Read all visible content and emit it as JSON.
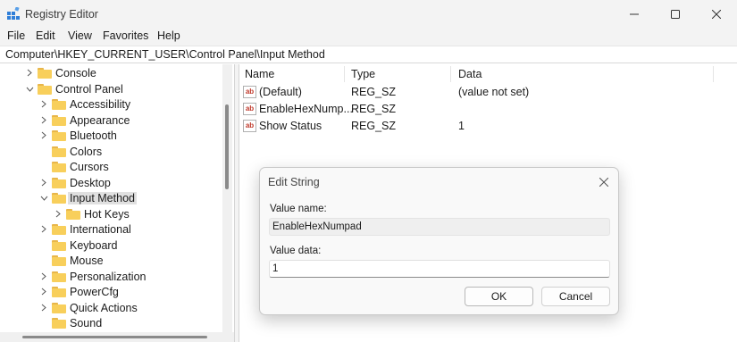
{
  "window": {
    "title": "Registry Editor",
    "icon": "registry-icon",
    "controls": {
      "minimize": "minimize-icon",
      "maximize": "maximize-icon",
      "close": "close-icon"
    }
  },
  "menu": [
    "File",
    "Edit",
    "View",
    "Favorites",
    "Help"
  ],
  "address": "Computer\\HKEY_CURRENT_USER\\Control Panel\\Input Method",
  "tree": [
    {
      "label": "Console",
      "expanded": false
    },
    {
      "label": "Control Panel",
      "expanded": true
    },
    {
      "label": "Accessibility",
      "expanded": false
    },
    {
      "label": "Appearance",
      "expanded": false
    },
    {
      "label": "Bluetooth",
      "expanded": false
    },
    {
      "label": "Colors",
      "expanded": false
    },
    {
      "label": "Cursors",
      "expanded": false
    },
    {
      "label": "Desktop",
      "expanded": false
    },
    {
      "label": "Input Method",
      "expanded": true,
      "selected": true
    },
    {
      "label": "Hot Keys",
      "expanded": false
    },
    {
      "label": "International",
      "expanded": false
    },
    {
      "label": "Keyboard",
      "expanded": false
    },
    {
      "label": "Mouse",
      "expanded": false
    },
    {
      "label": "Personalization",
      "expanded": false
    },
    {
      "label": "PowerCfg",
      "expanded": false
    },
    {
      "label": "Quick Actions",
      "expanded": false
    },
    {
      "label": "Sound",
      "expanded": false
    }
  ],
  "list": {
    "columns": [
      "Name",
      "Type",
      "Data"
    ],
    "rows": [
      {
        "name": "(Default)",
        "type": "REG_SZ",
        "data": "(value not set)"
      },
      {
        "name": "EnableHexNump...",
        "type": "REG_SZ",
        "data": ""
      },
      {
        "name": "Show Status",
        "type": "REG_SZ",
        "data": "1"
      }
    ]
  },
  "dialog": {
    "title": "Edit String",
    "value_name_label": "Value name:",
    "value_name": "EnableHexNumpad",
    "value_data_label": "Value data:",
    "value_data": "1",
    "ok_label": "OK",
    "cancel_label": "Cancel"
  },
  "colors": {
    "folder": "#f8cf5b",
    "selection": "#e0e0e0",
    "reg_icon_text": "#c0392b"
  }
}
